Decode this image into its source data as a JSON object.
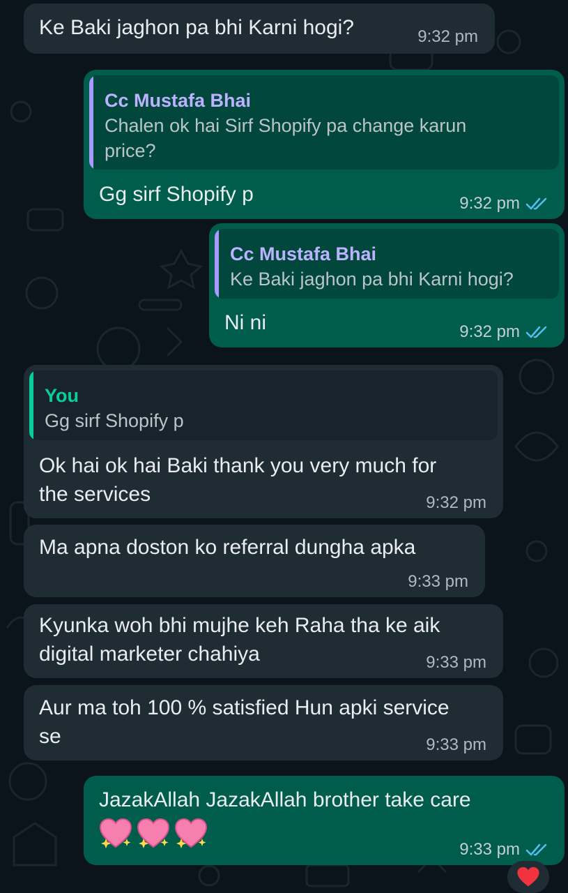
{
  "messages": [
    {
      "text": "Ke Baki jaghon pa bhi Karni hogi?",
      "time": "9:32 pm"
    },
    {
      "quote_author": "Cc Mustafa Bhai",
      "quote_text": "Chalen ok hai Sirf Shopify pa change karun price?",
      "text": "Gg sirf Shopify p",
      "time": "9:32 pm"
    },
    {
      "quote_author": "Cc Mustafa Bhai",
      "quote_text": "Ke Baki jaghon pa bhi Karni hogi?",
      "text": "Ni ni",
      "time": "9:32 pm"
    },
    {
      "quote_author": "You",
      "quote_text": "Gg sirf Shopify p",
      "text": "Ok hai ok hai Baki thank you very much for the services",
      "time": "9:32 pm"
    },
    {
      "text": "Ma apna doston ko referral dungha apka",
      "time": "9:33 pm"
    },
    {
      "text": "Kyunka woh bhi mujhe keh Raha tha ke aik digital marketer chahiya",
      "time": "9:33 pm"
    },
    {
      "text": "Aur ma toh 100 % satisfied Hun apki service se",
      "time": "9:33 pm"
    },
    {
      "text": "JazakAllah JazakAllah brother take care",
      "emojis": [
        "sparkling-heart",
        "sparkling-heart",
        "sparkling-heart"
      ],
      "time": "9:33 pm",
      "reaction": "red-heart"
    }
  ],
  "colors": {
    "background": "#0b141a",
    "incoming": "#1f2c34",
    "outgoing": "#005c4b",
    "read_ticks": "#53bdeb"
  }
}
